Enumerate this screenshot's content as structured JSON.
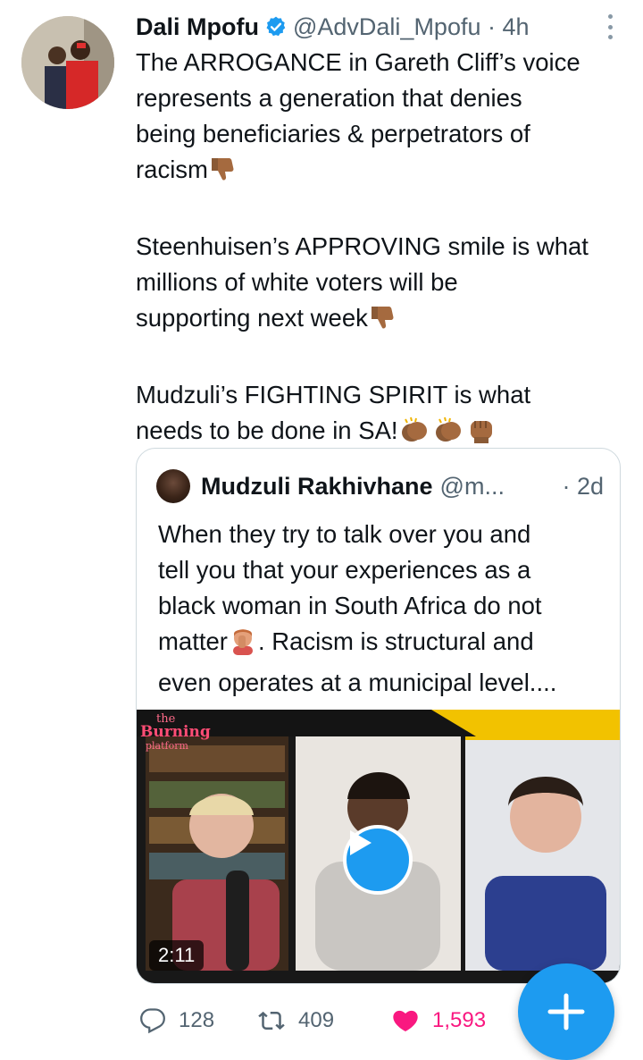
{
  "tweet": {
    "author_name": "Dali Mpofu",
    "verified_icon": "verified-badge-icon",
    "handle_time": "@AdvDali_Mpofu · 4h",
    "more_icon": "more-vertical-icon",
    "para1": [
      "The ARROGANCE in Gareth Cliff’s voice",
      "represents a generation that denies",
      "being beneficiaries & perpetrators of",
      "racism"
    ],
    "para2": [
      "Steenhuisen’s APPROVING smile is what",
      "millions of white voters will be",
      "supporting next week"
    ],
    "para3": [
      "Mudzuli’s FIGHTING SPIRIT is what",
      "needs to be done in SA!"
    ],
    "emojis": [
      "thumbs-down-emoji",
      "clapping-hands-emoji",
      "raised-fist-emoji"
    ]
  },
  "quoted": {
    "author_name": "Mudzuli Rakhivhane",
    "handle": "@m...",
    "time": "· 2d",
    "lines": [
      "When they try to talk over you and",
      "tell you that your experiences as a",
      "black woman in South Africa do not",
      "matter",
      ". Racism is structural and",
      "even operates at a municipal level...."
    ],
    "facepalm_emoji": "woman-facepalming-emoji",
    "video": {
      "duration": "2:11",
      "play_icon": "play-icon",
      "logo_text_top": "the",
      "logo_text_mid": "Burning",
      "logo_text_bottom": "platform"
    }
  },
  "actions": {
    "reply_count": "128",
    "retweet_count": "409",
    "like_count": "1,593",
    "reply_icon": "reply-icon",
    "retweet_icon": "retweet-icon",
    "like_icon": "heart-icon"
  },
  "fab": {
    "icon": "plus-icon"
  },
  "colors": {
    "accent": "#1d9bf0",
    "like": "#f91880",
    "secondary_text": "#536471"
  }
}
